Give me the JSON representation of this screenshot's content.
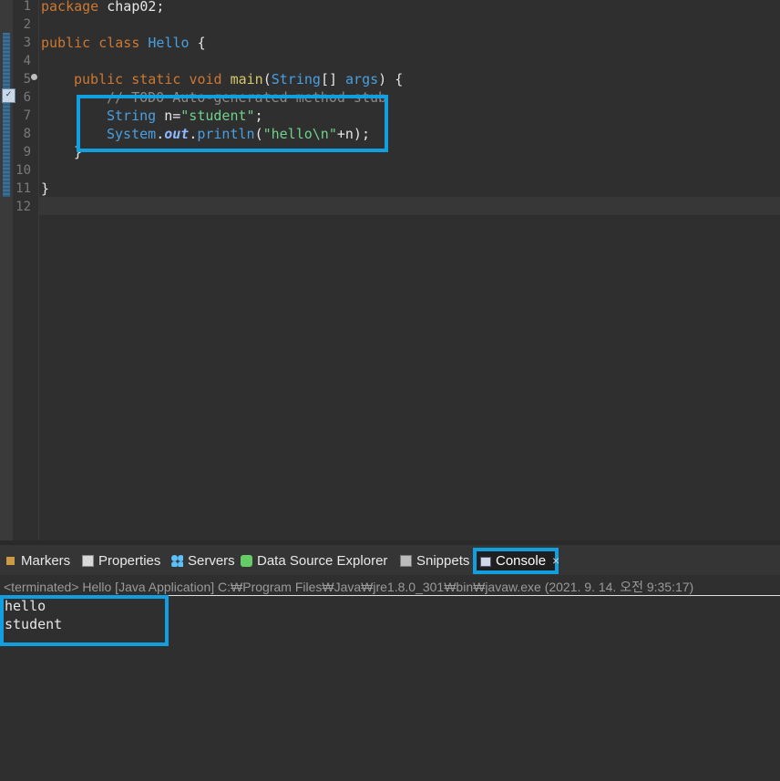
{
  "editor": {
    "line_numbers": [
      "1",
      "2",
      "3",
      "4",
      "5",
      "6",
      "7",
      "8",
      "9",
      "10",
      "11",
      "12"
    ],
    "lines": {
      "l1": {
        "kw": "package",
        "rest": " chap02;"
      },
      "l3": {
        "kw1": "public",
        "kw2": "class",
        "name": "Hello",
        "rest": " {"
      },
      "l5": {
        "kw1": "public",
        "kw2": "static",
        "kw3": "void",
        "fn": "main",
        "p1": "(",
        "type": "String",
        "p2": "[] ",
        "arg": "args",
        "p3": ") {"
      },
      "l6": {
        "comment": "// TODO Auto-generated method stub"
      },
      "l7": {
        "type": "String",
        "rest1": " n=",
        "str": "\"student\"",
        "rest2": ";"
      },
      "l8": {
        "cls": "System",
        "dot1": ".",
        "field": "out",
        "dot2": ".",
        "method": "println",
        "p1": "(",
        "str": "\"hello\\n\"",
        "rest": "+n);"
      },
      "l9": {
        "text": "}"
      },
      "l11": {
        "text": "}"
      }
    }
  },
  "tabs": {
    "markers": "Markers",
    "properties": "Properties",
    "servers": "Servers",
    "data_source_explorer": "Data Source Explorer",
    "snippets": "Snippets",
    "console": "Console",
    "close": "×"
  },
  "console": {
    "status": "<terminated> Hello [Java Application] C:₩Program Files₩Java₩jre1.8.0_301₩bin₩javaw.exe (2021. 9. 14. 오전 9:35:17)",
    "output": [
      "hello",
      "student"
    ]
  },
  "colors": {
    "highlight": "#119fe0",
    "keyword": "#cc7832",
    "type": "#4a9fe0",
    "string": "#6fd18c"
  }
}
